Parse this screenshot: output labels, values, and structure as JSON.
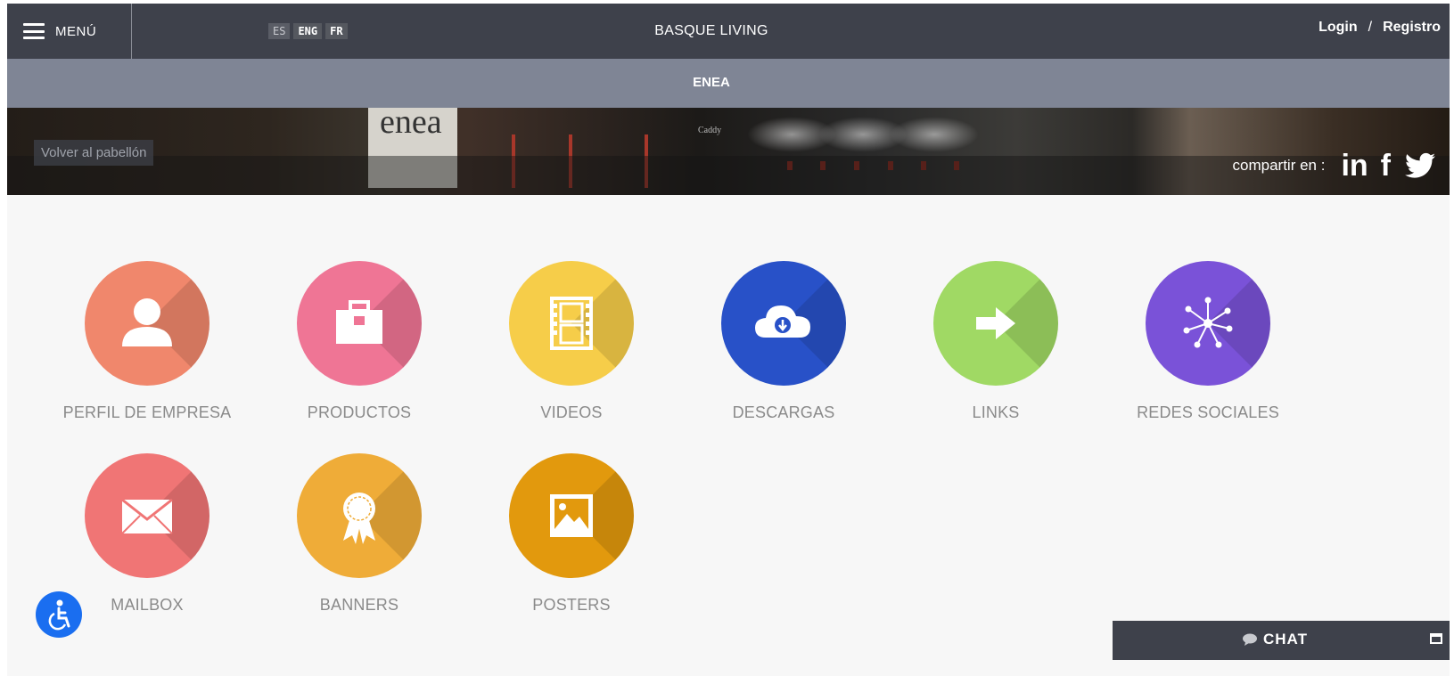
{
  "header": {
    "menu_label": "MENÚ",
    "languages": [
      "ES",
      "ENG",
      "FR"
    ],
    "site_title": "BASQUE LIVING",
    "login": "Login",
    "separator": "/",
    "register": "Registro"
  },
  "subheader": {
    "title": "ENEA"
  },
  "banner": {
    "brand_text": "enea",
    "small_text": "Caddy",
    "back_label": "Volver al pabellón",
    "share_label": "compartir en :",
    "social": {
      "linkedin": "in",
      "facebook": "f"
    }
  },
  "tiles": [
    {
      "label": "PERFIL DE EMPRESA",
      "color": "#f0876c",
      "icon": "user-icon"
    },
    {
      "label": "PRODUCTOS",
      "color": "#ef7595",
      "icon": "briefcase-icon"
    },
    {
      "label": "VIDEOS",
      "color": "#f6cd49",
      "icon": "film-icon"
    },
    {
      "label": "DESCARGAS",
      "color": "#2851c8",
      "icon": "cloud-download-icon"
    },
    {
      "label": "LINKS",
      "color": "#a0d964",
      "icon": "arrow-right-icon"
    },
    {
      "label": "REDES SOCIALES",
      "color": "#7a52d8",
      "icon": "network-icon"
    },
    {
      "label": "MAILBOX",
      "color": "#f07575",
      "icon": "envelope-icon"
    },
    {
      "label": "BANNERS",
      "color": "#efac38",
      "icon": "award-ribbon-icon"
    },
    {
      "label": "POSTERS",
      "color": "#e2990d",
      "icon": "picture-icon"
    }
  ],
  "chat": {
    "label": "CHAT"
  }
}
